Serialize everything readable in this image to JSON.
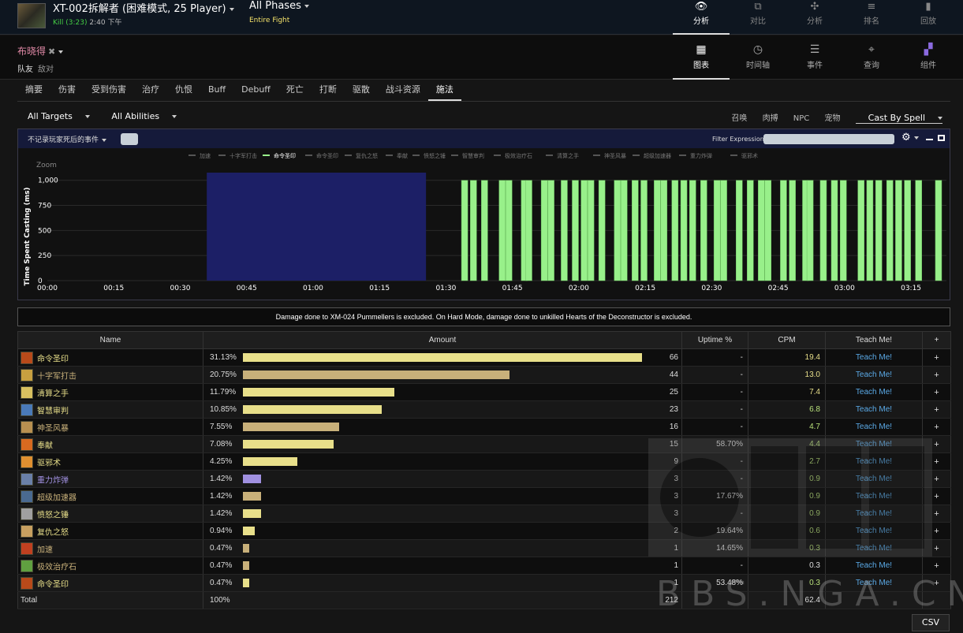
{
  "encounter": {
    "title": "XT-002拆解者 (困难模式, 25 Player)",
    "kill": "Kill (3:23)",
    "time": "2:40 下午",
    "phase": "All Phases",
    "phase_sub": "Entire Fight"
  },
  "top_nav": [
    {
      "label": "分析",
      "icon": "eye-icon",
      "glyph": "👁",
      "active": true
    },
    {
      "label": "对比",
      "icon": "compare-icon",
      "glyph": "⧉",
      "active": false
    },
    {
      "label": "分析",
      "icon": "puzzle-icon",
      "glyph": "✣",
      "active": false
    },
    {
      "label": "排名",
      "icon": "list-icon",
      "glyph": "≡",
      "active": false
    },
    {
      "label": "回放",
      "icon": "replay-icon",
      "glyph": "▮",
      "active": false
    }
  ],
  "player": {
    "name": "布晓得",
    "friendly": "队友",
    "enemy": "敌对"
  },
  "view_nav": [
    {
      "label": "图表",
      "icon": "grid-icon",
      "glyph": "▦",
      "active": true
    },
    {
      "label": "时间轴",
      "icon": "clock-icon",
      "glyph": "◷",
      "active": false
    },
    {
      "label": "事件",
      "icon": "list-icon",
      "glyph": "☰",
      "active": false
    },
    {
      "label": "查询",
      "icon": "pin-icon",
      "glyph": "⌖",
      "active": false
    },
    {
      "label": "组件",
      "icon": "widgets-icon",
      "glyph": "▞",
      "active": false
    }
  ],
  "tabs": [
    "摘要",
    "伤害",
    "受到伤害",
    "治疗",
    "仇恨",
    "Buff",
    "Debuff",
    "死亡",
    "打断",
    "驱散",
    "战斗资源",
    "施法"
  ],
  "active_tab": 11,
  "filters": {
    "targets": "All Targets",
    "abilities": "All Abilities"
  },
  "right_filters": {
    "summon": "召唤",
    "melee": "肉搏",
    "npc": "NPC",
    "pet": "宠物",
    "cast_by": "Cast By Spell"
  },
  "chart_panel": {
    "checkbox_label": "不记录玩家死后的事件",
    "filter_label": "Filter Expression:",
    "zoom": "Zoom"
  },
  "chart_data": {
    "type": "bar",
    "ylabel": "Time Spent Casting (ms)",
    "ylim": [
      0,
      1100
    ],
    "yticks": [
      "0",
      "250",
      "500",
      "750",
      "1,000"
    ],
    "xticks": [
      "00:00",
      "00:15",
      "00:30",
      "00:45",
      "01:00",
      "01:15",
      "01:30",
      "01:45",
      "02:00",
      "02:15",
      "02:30",
      "02:45",
      "03:00",
      "03:15"
    ],
    "xlim_seconds": [
      0,
      203
    ],
    "legend": [
      "加速",
      "十字军打击",
      "命令圣印",
      "命令圣印",
      "复仇之怒",
      "奉献",
      "愤怒之锤",
      "智慧审判",
      "极效治疗石",
      "清算之手",
      "神圣风暴",
      "超级加速器",
      "重力炸弹",
      "驱邪术"
    ],
    "legend_active": 2,
    "highlight_range_seconds": [
      36,
      85.5
    ],
    "bar_value": 1000,
    "bar_times_seconds": [
      93.5,
      95.5,
      98,
      102,
      103.5,
      107,
      108,
      111.5,
      113,
      116,
      118.5,
      120.5,
      122,
      124.5,
      128,
      129.5,
      132,
      134,
      137,
      138.5,
      141,
      143,
      145,
      147.5,
      150.5,
      152,
      155.5,
      158,
      160.5,
      162,
      165.5,
      167.5,
      170.5,
      171.5,
      174.5,
      177,
      179,
      183,
      185,
      187,
      189.5,
      191.5,
      193.5,
      196,
      200.5
    ]
  },
  "banner": "Damage done to XM-024 Pummellers is excluded. On Hard Mode, damage done to unkilled Hearts of the Deconstructor is excluded.",
  "table": {
    "headers": {
      "name": "Name",
      "amount": "Amount",
      "uptime": "Uptime %",
      "cpm": "CPM",
      "teach": "Teach Me!",
      "plus": "+"
    },
    "rows": [
      {
        "name": "命令圣印",
        "pct": "31.13%",
        "frac": 1.0,
        "count": "66",
        "uptime": "-",
        "cpm": "19.4",
        "teach": "Teach Me!",
        "color": "#e8df8a",
        "cpm_color": "#e8df8a",
        "icon": "#b84a1a"
      },
      {
        "name": "十字军打击",
        "pct": "20.75%",
        "frac": 0.667,
        "count": "44",
        "uptime": "-",
        "cpm": "13.0",
        "teach": "Teach Me!",
        "color": "#c8b07a",
        "cpm_color": "#e8df8a",
        "icon": "#c8a040"
      },
      {
        "name": "清算之手",
        "pct": "11.79%",
        "frac": 0.379,
        "count": "25",
        "uptime": "-",
        "cpm": "7.4",
        "teach": "Teach Me!",
        "color": "#e8df8a",
        "cpm_color": "#e8df8a",
        "icon": "#d8c060"
      },
      {
        "name": "智慧审判",
        "pct": "10.85%",
        "frac": 0.348,
        "count": "23",
        "uptime": "-",
        "cpm": "6.8",
        "teach": "Teach Me!",
        "color": "#e8df8a",
        "cpm_color": "#b8e07a",
        "icon": "#4a7ab8"
      },
      {
        "name": "神圣风暴",
        "pct": "7.55%",
        "frac": 0.242,
        "count": "16",
        "uptime": "-",
        "cpm": "4.7",
        "teach": "Teach Me!",
        "color": "#c8b07a",
        "cpm_color": "#b8e07a",
        "icon": "#b89050"
      },
      {
        "name": "奉献",
        "pct": "7.08%",
        "frac": 0.227,
        "count": "15",
        "uptime": "58.70%",
        "cpm": "4.4",
        "teach": "Teach Me!",
        "color": "#e8df8a",
        "cpm_color": "#b8e07a",
        "icon": "#d86a20"
      },
      {
        "name": "驱邪术",
        "pct": "4.25%",
        "frac": 0.136,
        "count": "9",
        "uptime": "-",
        "cpm": "2.7",
        "teach": "Teach Me!",
        "color": "#e8df8a",
        "cpm_color": "#b8e07a",
        "icon": "#e09030"
      },
      {
        "name": "重力炸弹",
        "pct": "1.42%",
        "frac": 0.045,
        "count": "3",
        "uptime": "-",
        "cpm": "0.9",
        "teach": "Teach Me!",
        "color": "#a090e0",
        "cpm_color": "#b8e07a",
        "icon": "#6a80a8"
      },
      {
        "name": "超级加速器",
        "pct": "1.42%",
        "frac": 0.045,
        "count": "3",
        "uptime": "17.67%",
        "cpm": "0.9",
        "teach": "Teach Me!",
        "color": "#c8b07a",
        "cpm_color": "#b8e07a",
        "icon": "#4a6a90"
      },
      {
        "name": "愤怒之锤",
        "pct": "1.42%",
        "frac": 0.045,
        "count": "3",
        "uptime": "-",
        "cpm": "0.9",
        "teach": "Teach Me!",
        "color": "#e8df8a",
        "cpm_color": "#b8e07a",
        "icon": "#a0a0a0"
      },
      {
        "name": "复仇之怒",
        "pct": "0.94%",
        "frac": 0.03,
        "count": "2",
        "uptime": "19.64%",
        "cpm": "0.6",
        "teach": "Teach Me!",
        "color": "#e8df8a",
        "cpm_color": "#b8e07a",
        "icon": "#c8a060"
      },
      {
        "name": "加速",
        "pct": "0.47%",
        "frac": 0.015,
        "count": "1",
        "uptime": "14.65%",
        "cpm": "0.3",
        "teach": "Teach Me!",
        "color": "#c8b07a",
        "cpm_color": "#b8e07a",
        "icon": "#c04020"
      },
      {
        "name": "极效治疗石",
        "pct": "0.47%",
        "frac": 0.015,
        "count": "1",
        "uptime": "-",
        "cpm": "0.3",
        "teach": "Teach Me!",
        "color": "#c8b07a",
        "cpm_color": "#dddddd",
        "icon": "#60a040"
      },
      {
        "name": "命令圣印",
        "pct": "0.47%",
        "frac": 0.015,
        "count": "1",
        "uptime": "53.48%",
        "cpm": "0.3",
        "teach": "Teach Me!",
        "color": "#e8df8a",
        "cpm_color": "#b8e07a",
        "icon": "#b84a1a"
      }
    ],
    "total": {
      "label": "Total",
      "pct": "100%",
      "count": "212",
      "cpm": "62.4"
    }
  },
  "csv_label": "CSV",
  "watermark": "BBS.NGA.CN",
  "colors": {
    "bar_green": "#98f08a",
    "highlight": "#1c1f66",
    "grid": "#333333"
  }
}
